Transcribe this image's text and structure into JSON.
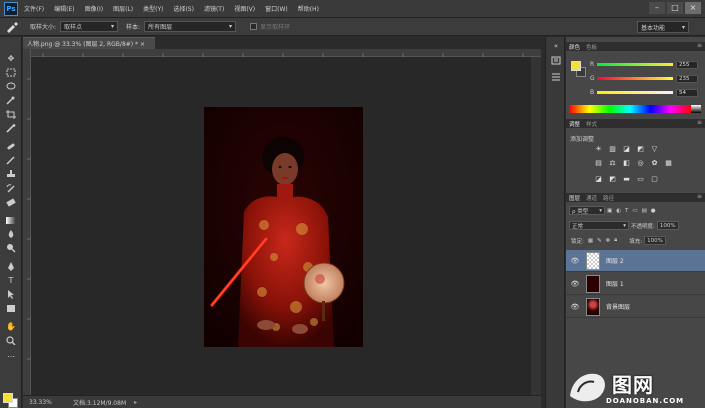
{
  "app": {
    "logo": "Ps"
  },
  "menu": [
    "文件(F)",
    "编辑(E)",
    "图像(I)",
    "图层(L)",
    "类型(Y)",
    "选择(S)",
    "滤镜(T)",
    "视图(V)",
    "窗口(W)",
    "帮助(H)"
  ],
  "window_controls": {
    "minimize": "–",
    "maximize": "□",
    "close": "×"
  },
  "options": {
    "sample_size_label": "取样大小:",
    "sample_size_value": "取样点",
    "sample_label": "样本:",
    "sample_value": "所有图层",
    "show_ring_label": "显示取样环",
    "workspace": "基本功能"
  },
  "document": {
    "tab_title": "人物.png @ 33.3% (图层 2, RGB/8#) * ×",
    "zoom": "33.33%",
    "info": "文档:3.12M/9.08M"
  },
  "color_panel": {
    "tabs": [
      "颜色",
      "色板"
    ],
    "channels": [
      {
        "letter": "R",
        "value": "255"
      },
      {
        "letter": "G",
        "value": "235"
      },
      {
        "letter": "B",
        "value": "54"
      }
    ],
    "foreground": "#f5e03a"
  },
  "adjustments_panel": {
    "tabs": [
      "调整",
      "样式"
    ],
    "title": "添加调整"
  },
  "layers_panel": {
    "tabs": [
      "图层",
      "通道",
      "路径"
    ],
    "filter_kind": "ρ 类型",
    "blend_mode": "正常",
    "opacity_label": "不透明度:",
    "opacity_value": "100%",
    "lock_label": "锁定:",
    "fill_label": "填充:",
    "fill_value": "100%",
    "layers": [
      {
        "name": "图层 2",
        "selected": true
      },
      {
        "name": "图层 1",
        "selected": false
      },
      {
        "name": "背景图层",
        "selected": false
      }
    ]
  },
  "watermark": {
    "text": "图网",
    "site": "DOANOBAN.COM"
  }
}
